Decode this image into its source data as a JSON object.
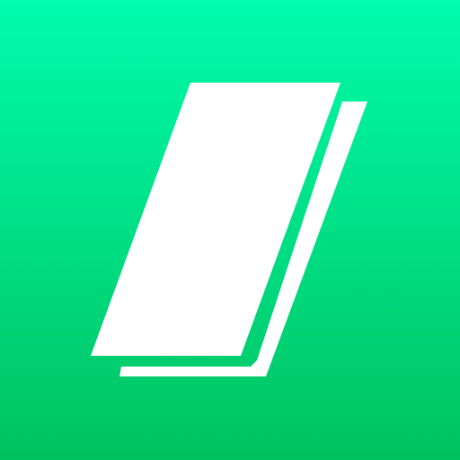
{
  "app_icon": {
    "icon": "stacked-pages-icon",
    "colors": {
      "background_top": "#00fcad",
      "background_bottom": "#00c25f",
      "foreground": "#ffffff"
    }
  }
}
